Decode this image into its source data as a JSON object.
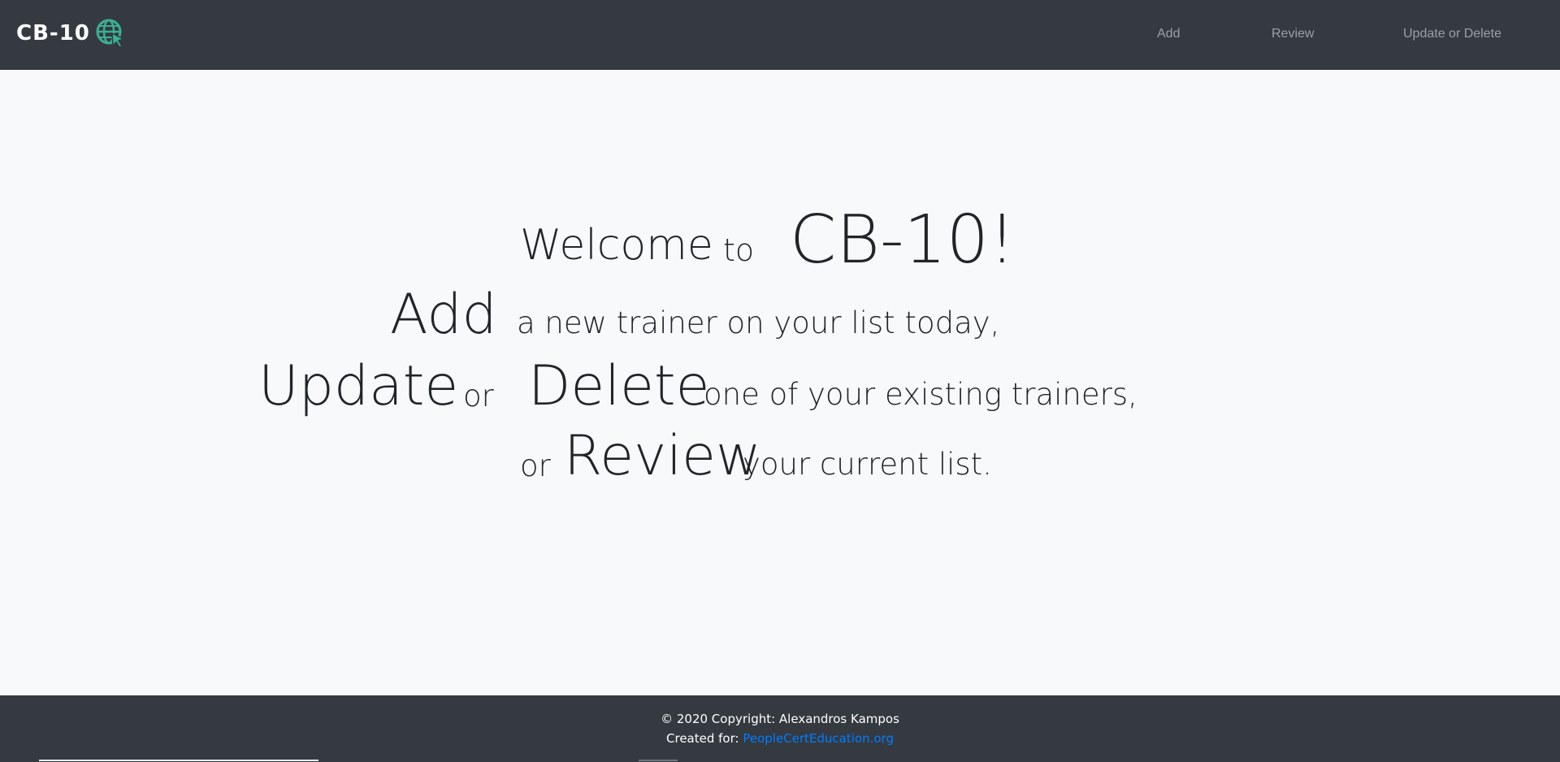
{
  "nav": {
    "brand": "CB-10",
    "brand_icon": "globe-cursor-icon",
    "brand_icon_color": "#3bb08f",
    "links": {
      "add": "Add",
      "review": "Review",
      "update_delete": "Update or Delete"
    }
  },
  "hero": {
    "line1": {
      "welcome": "Welcome",
      "to": "to",
      "name": "CB-10!"
    },
    "line2": {
      "add": "Add",
      "rest": "a new trainer on your list today,"
    },
    "line3": {
      "update": "Update",
      "or": "or",
      "delete": "Delete",
      "rest": "one of your existing trainers,"
    },
    "line4": {
      "or": "or",
      "review": "Review",
      "rest": "your current list."
    }
  },
  "footer": {
    "copyright": "© 2020 Copyright: Alexandros Kampos",
    "created_for_label": "Created for:",
    "created_for_link": "PeopleCertEducation.org"
  },
  "colors": {
    "navbar_bg": "#343a40",
    "page_bg": "#f8f9fa",
    "link_blue": "#007bff",
    "nav_link": "#9aa0a6"
  }
}
